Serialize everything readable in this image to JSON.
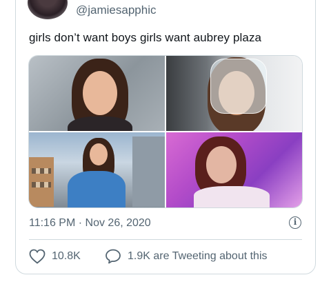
{
  "author": {
    "handle": "@jamiesapphic",
    "avatar_icon": "profile-avatar"
  },
  "tweet": {
    "text": "girls don’t want boys girls want aubrey plaza",
    "photos": [
      {
        "icon": "photo-portrait-grey-backdrop"
      },
      {
        "icon": "photo-face-shield"
      },
      {
        "icon": "photo-city-balcony"
      },
      {
        "icon": "photo-pink-neon-room"
      }
    ]
  },
  "meta": {
    "timestamp": "11:16 PM · Nov 26, 2020",
    "info_icon": "info-icon"
  },
  "actions": {
    "likes": "10.8K",
    "conversation": "1.9K are Tweeting about this"
  },
  "colors": {
    "secondary_text": "#536471",
    "border": "#cfd9de",
    "primary_text": "#0f1419"
  }
}
